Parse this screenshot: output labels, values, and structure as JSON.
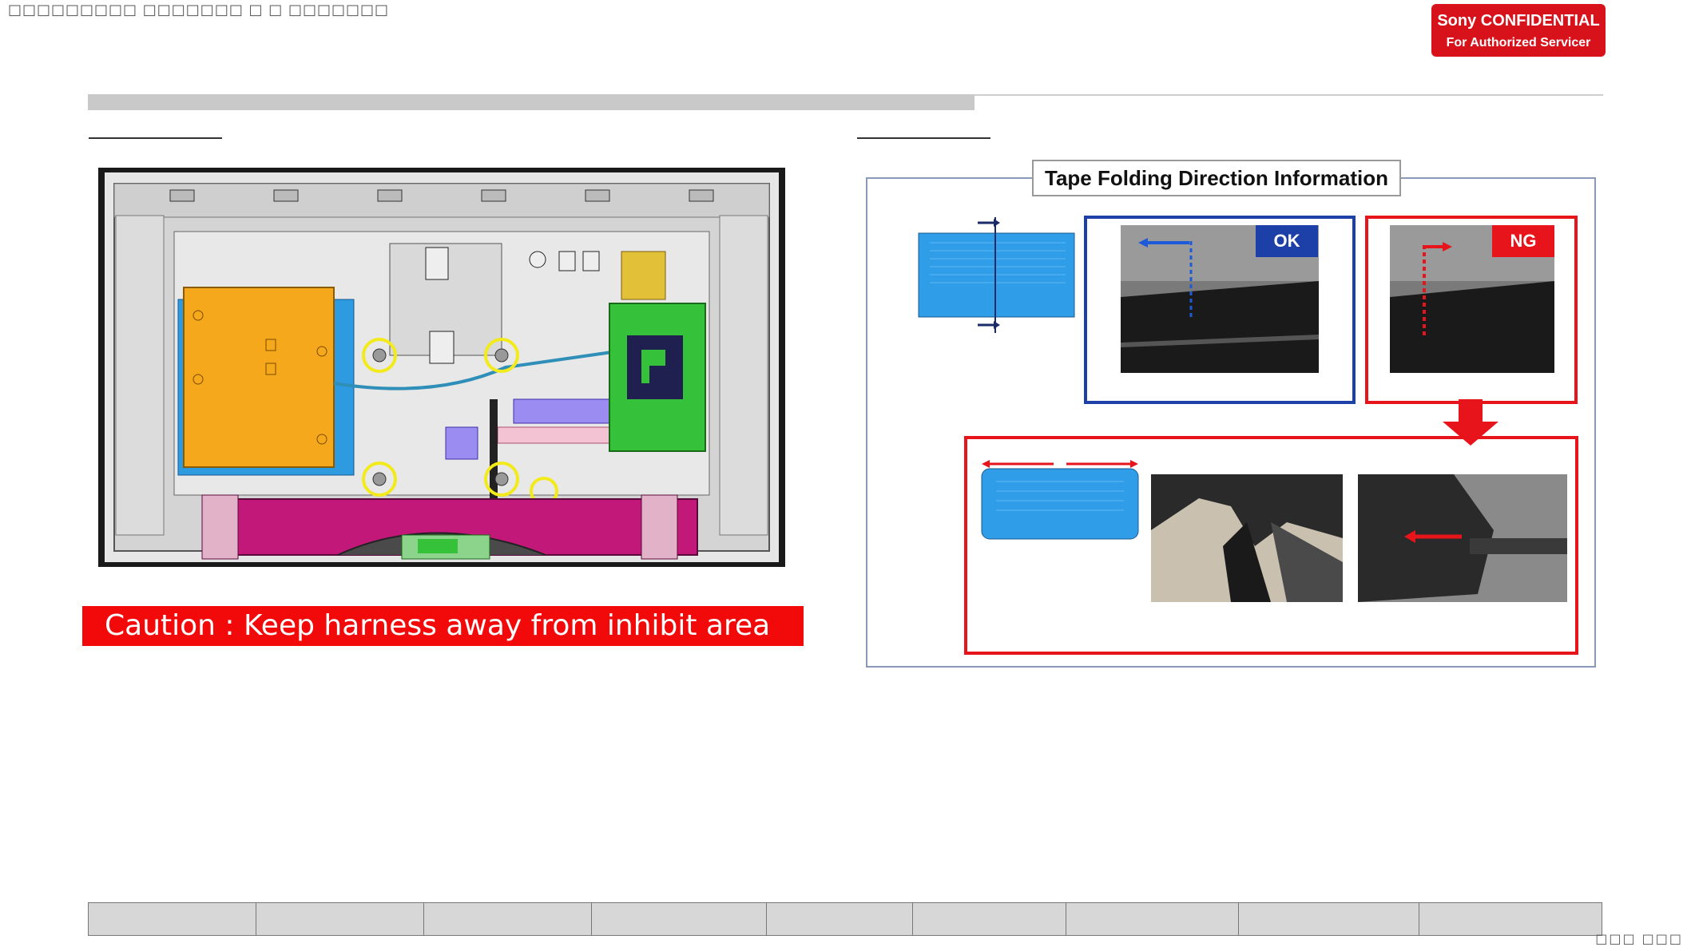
{
  "header": {
    "doc_title": "□□□□□□□□□ □□□□□□□ □ □ □□□□□□□",
    "confidential_line1": "Sony CONFIDENTIAL",
    "confidential_line2": "For Authorized Servicer"
  },
  "left_panel": {
    "caution_text": "Caution : Keep harness away from inhibit area"
  },
  "right_panel": {
    "title": "Tape Folding Direction Information",
    "ok_label": "OK",
    "ng_label": "NG"
  },
  "footer": {
    "cells": [
      "",
      "",
      "",
      "",
      "",
      "",
      "",
      "",
      ""
    ],
    "page_number": "□□□ □□□"
  },
  "colors": {
    "confidential_red": "#d8121b",
    "caution_red": "#f20a0a",
    "ok_blue": "#1c3fa8",
    "ng_red": "#e8141c",
    "board_orange": "#f5a81c",
    "board_green": "#35c23a",
    "board_magenta": "#c2187a",
    "screw_yellow": "#f2ea1a"
  }
}
